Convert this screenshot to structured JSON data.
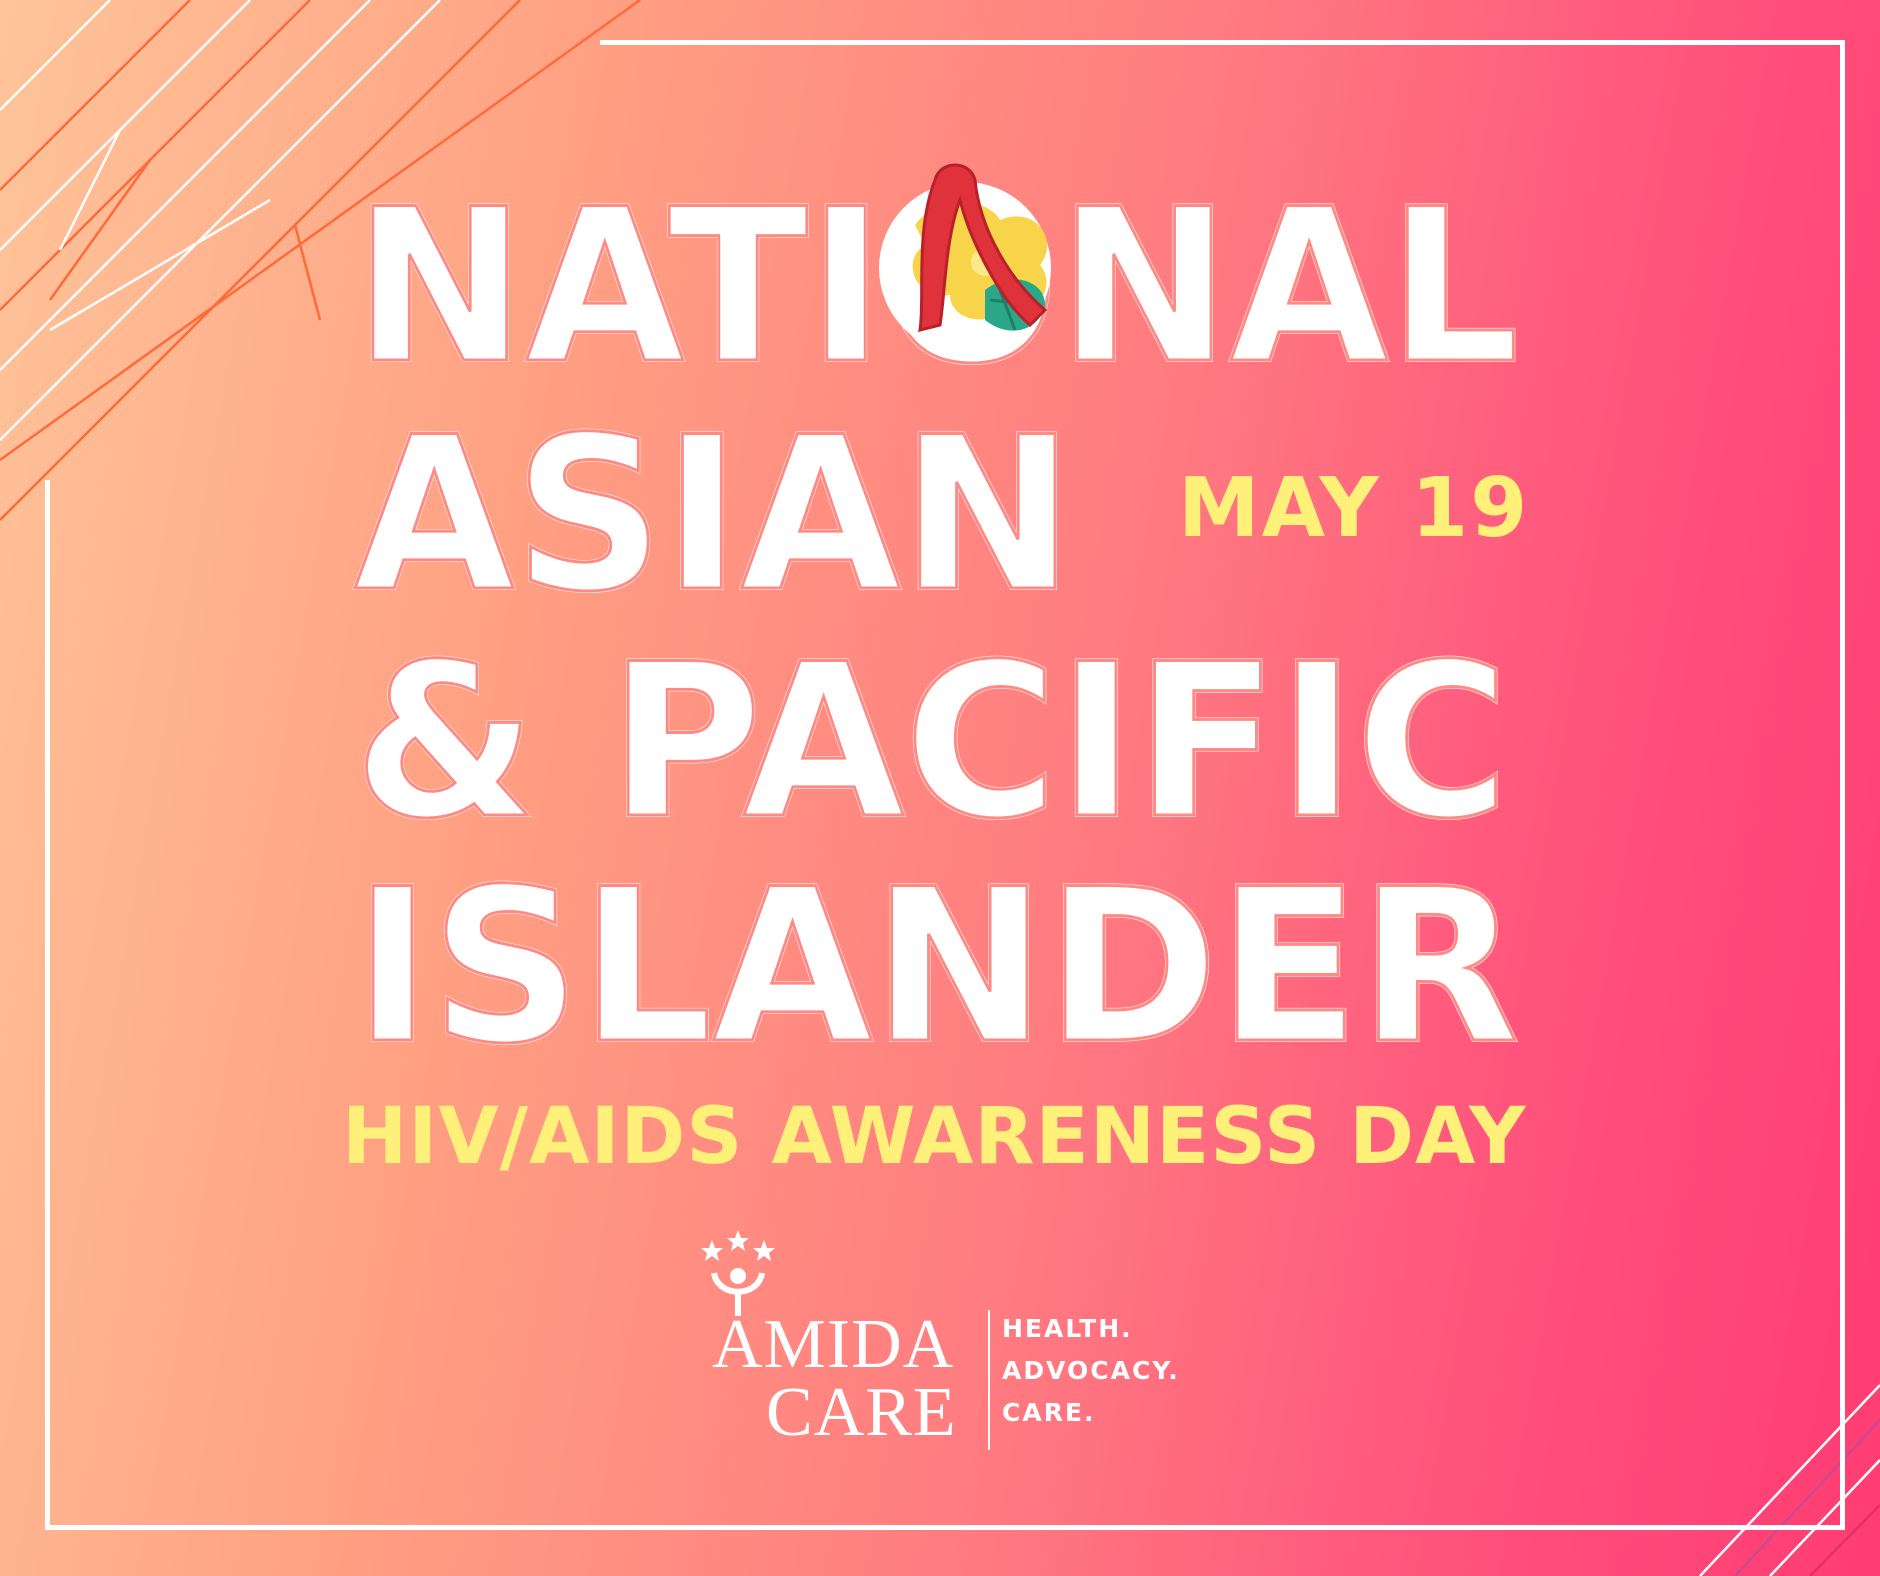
{
  "headline": {
    "line1": "NATIONAL",
    "line2": "ASIAN",
    "line3": "& PACIFIC",
    "line4": "ISLANDER"
  },
  "date": "MAY 19",
  "subtitle": "HIV/AIDS AWARENESS DAY",
  "logo": {
    "name_line1": "AMIDA",
    "name_line2": "CARE",
    "tagline": [
      "HEALTH.",
      "ADVOCACY.",
      "CARE."
    ]
  },
  "colors": {
    "gradient_start": "#ffc49a",
    "gradient_end": "#ff3c73",
    "headline": "#ffffff",
    "accent_yellow": "#fff07a",
    "ribbon_red": "#e0323a",
    "flower_yellow": "#f7d44a",
    "leaf_teal": "#2aa889"
  },
  "icons": [
    "red-ribbon-icon",
    "hibiscus-flower-icon",
    "amida-care-stars-icon"
  ]
}
